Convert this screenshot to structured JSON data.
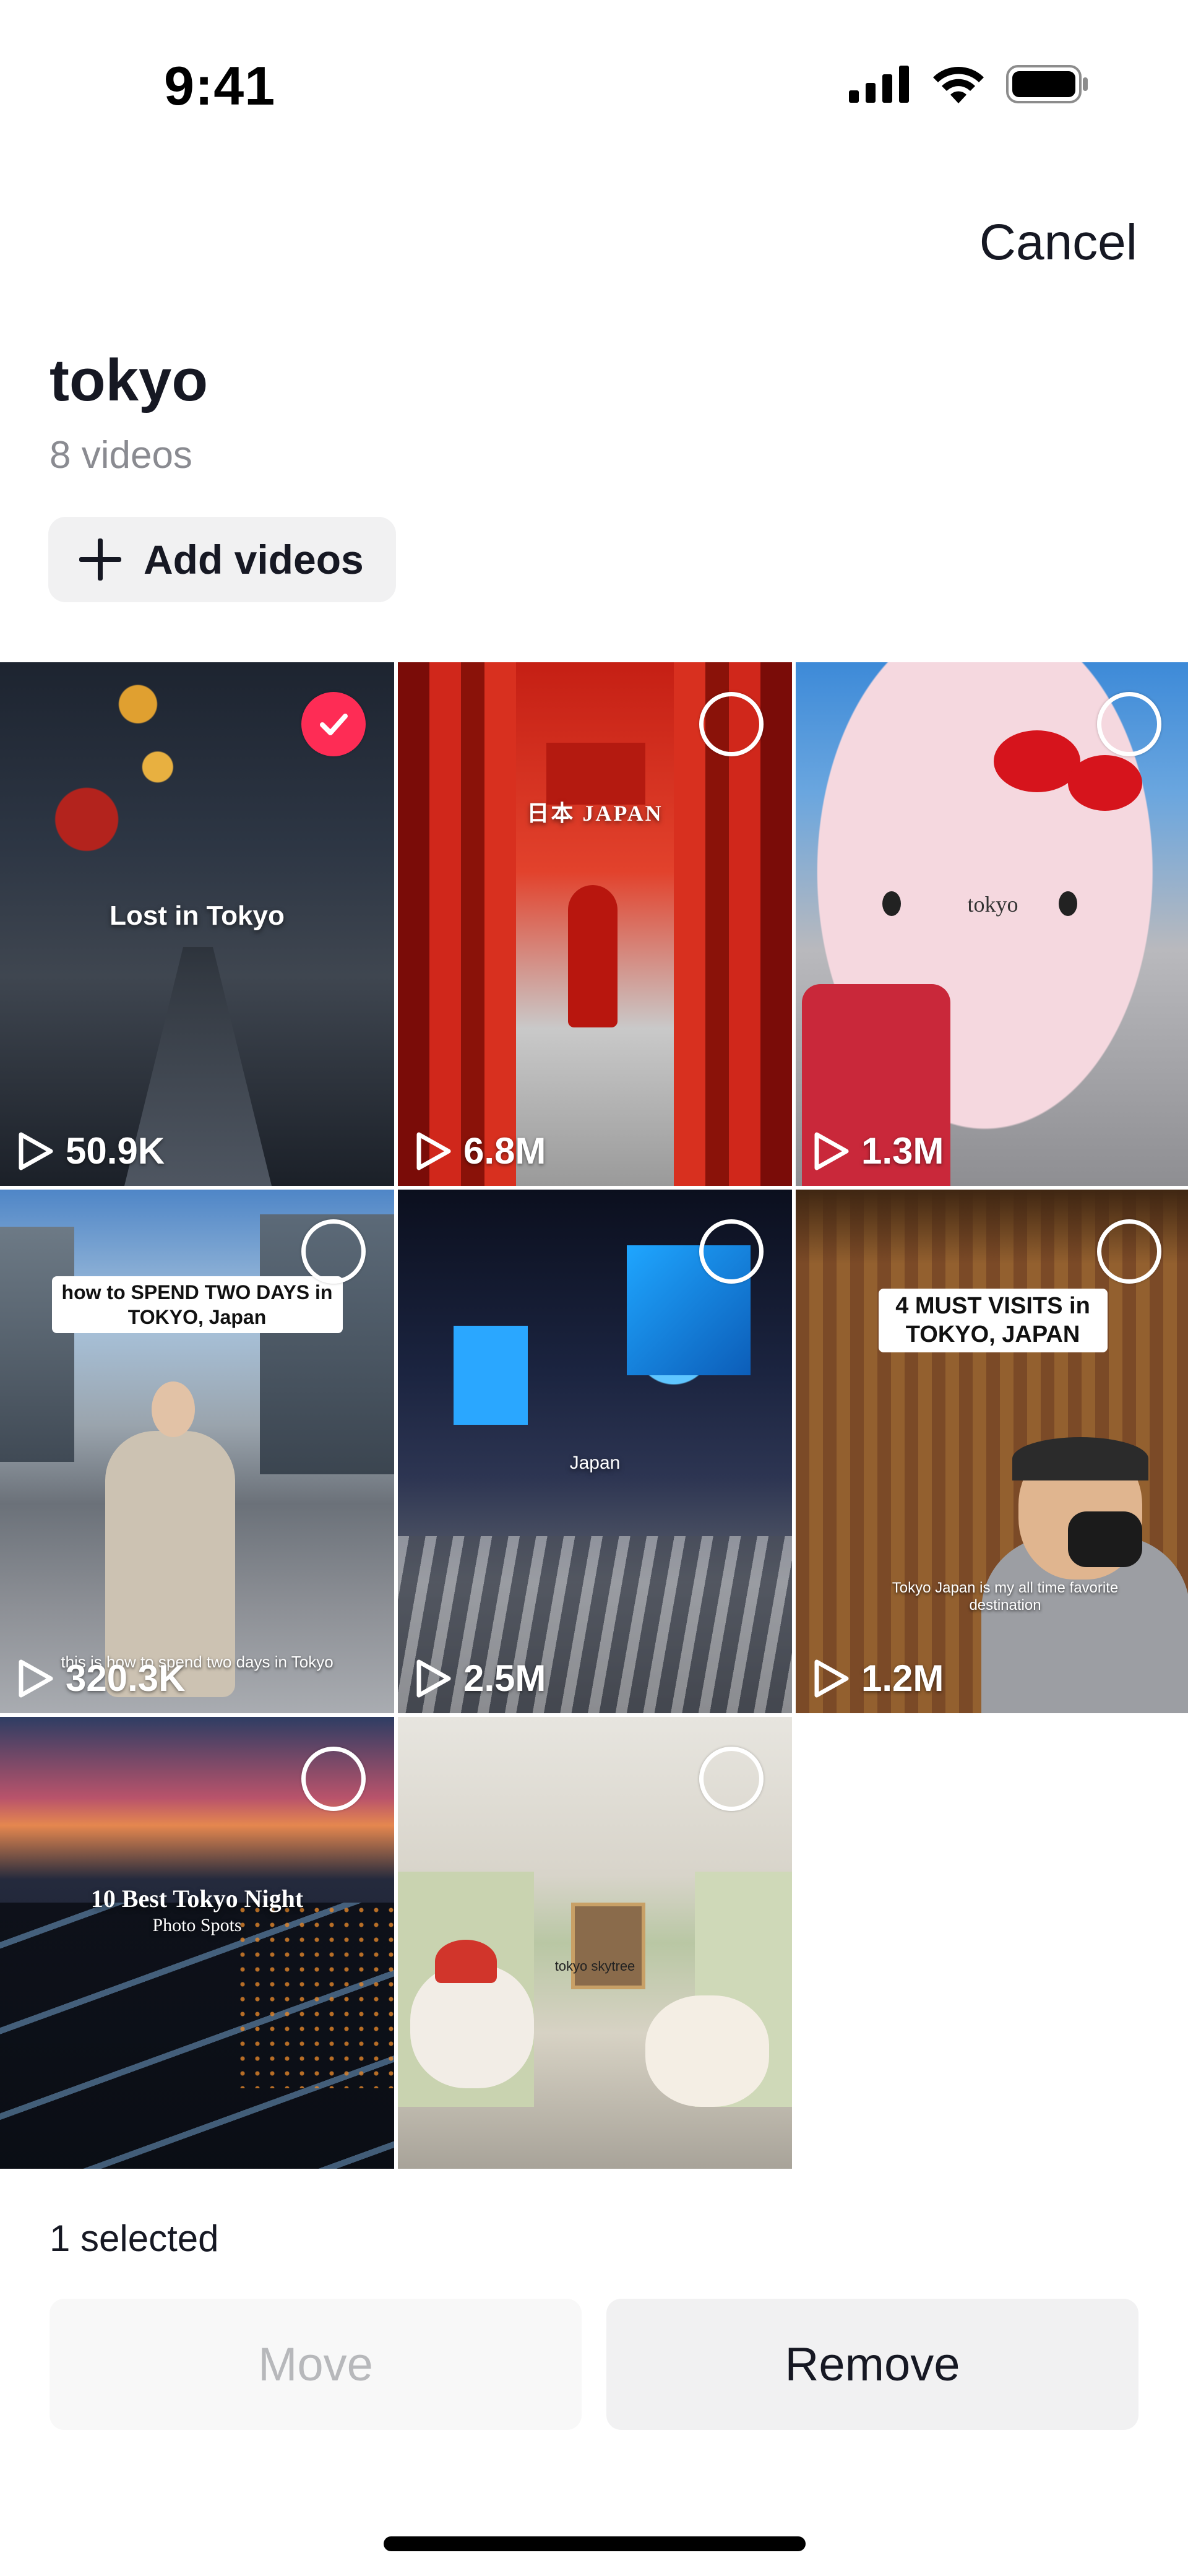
{
  "status_bar": {
    "time": "9:41",
    "icons": [
      "signal-icon",
      "wifi-icon",
      "battery-icon"
    ]
  },
  "header": {
    "cancel_label": "Cancel"
  },
  "collection": {
    "title": "tokyo",
    "count_label": "8 videos"
  },
  "add_videos": {
    "label": "Add videos",
    "icon": "plus-icon"
  },
  "videos": [
    {
      "caption": "Lost in Tokyo",
      "views": "50.9K",
      "selected": true
    },
    {
      "caption": "日本 JAPAN",
      "views": "6.8M",
      "selected": false
    },
    {
      "caption": "tokyo",
      "views": "1.3M",
      "selected": false
    },
    {
      "caption": "how to SPEND TWO DAYS in TOKYO, Japan",
      "subcaption": "this is how to spend two days in Tokyo",
      "views": "320.3K",
      "selected": false
    },
    {
      "caption": "Japan",
      "views": "2.5M",
      "selected": false
    },
    {
      "caption": "4 MUST VISITS in TOKYO, JAPAN",
      "subcaption": "Tokyo Japan is my all time favorite destination",
      "views": "1.2M",
      "selected": false
    },
    {
      "caption": "10 Best Tokyo Night",
      "subcaption": "Photo Spots",
      "views": "",
      "selected": false
    },
    {
      "caption": "tokyo skytree",
      "views": "",
      "selected": false
    }
  ],
  "footer": {
    "selected_label": "1 selected",
    "move_label": "Move",
    "remove_label": "Remove"
  },
  "colors": {
    "accent": "#fe2c55",
    "text_primary": "#161823",
    "text_secondary": "#8a8b91",
    "button_bg": "#f1f1f2"
  }
}
